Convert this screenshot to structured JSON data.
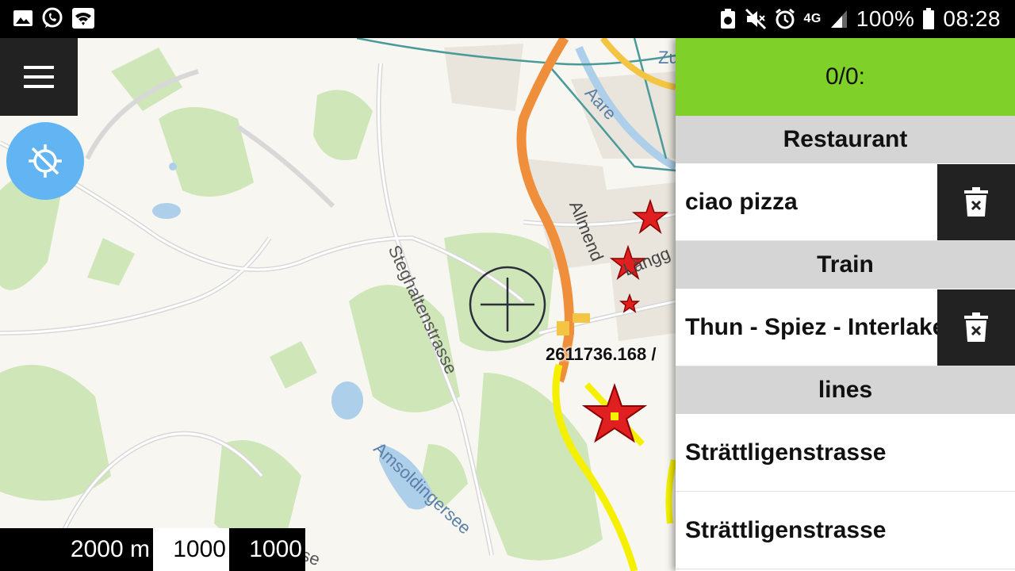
{
  "status_bar": {
    "left_icons": [
      "image-icon",
      "whatsapp-icon",
      "wifi-icon"
    ],
    "right_icons": [
      "recycle-icon",
      "mute-icon",
      "vibrate-icon",
      "alarm-icon",
      "4g-icon",
      "signal-icon"
    ],
    "network_type": "4G",
    "battery": "100%",
    "time": "08:28"
  },
  "map": {
    "coordinate_readout": "2611736.168 /",
    "labels": {
      "aare": "Aare",
      "zu": "Zu",
      "allmend": "Allmend",
      "steghalten": "Steghaltenstrasse",
      "amsoldingersee": "Amsoldingersee",
      "langg": "Längg",
      "strasse": "Strasse"
    },
    "scale": {
      "left": "2000 m",
      "middle": "1000",
      "right": "1000"
    },
    "colors": {
      "accent_green": "#80d02a",
      "gps_blue": "#62b4f3",
      "marker_red": "#e02020",
      "route_yellow": "#f5f000"
    }
  },
  "panel": {
    "header": "0/0:",
    "groups": [
      {
        "title": "Restaurant",
        "items": [
          {
            "label": "ciao pizza",
            "deletable": true
          }
        ]
      },
      {
        "title": "Train",
        "items": [
          {
            "label": "Thun - Spiez - Interlaken",
            "deletable": true
          }
        ]
      },
      {
        "title": "lines",
        "items": [
          {
            "label": "Strättligenstrasse",
            "deletable": false
          },
          {
            "label": "Strättligenstrasse",
            "deletable": false
          }
        ]
      }
    ]
  }
}
